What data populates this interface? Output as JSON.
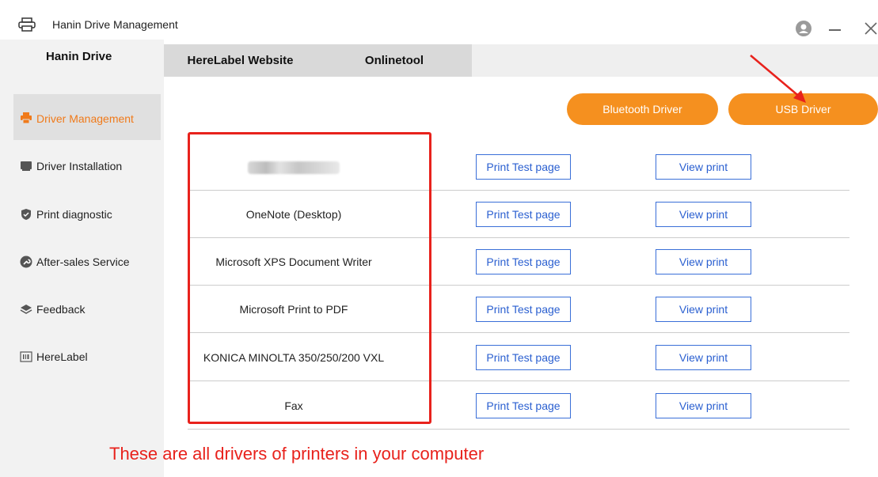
{
  "window": {
    "title": "Hanin Drive Management"
  },
  "tabs": {
    "active": "Hanin Drive",
    "items": [
      "HereLabel Website",
      "Onlinetool"
    ]
  },
  "sidebar": {
    "items": [
      {
        "label": "Driver Management",
        "icon": "printer-icon",
        "active": true
      },
      {
        "label": "Driver Installation",
        "icon": "monitor-icon",
        "active": false
      },
      {
        "label": "Print diagnostic",
        "icon": "shield-icon",
        "active": false
      },
      {
        "label": "After-sales Service",
        "icon": "wrench-icon",
        "active": false
      },
      {
        "label": "Feedback",
        "icon": "layers-icon",
        "active": false
      },
      {
        "label": "HereLabel",
        "icon": "barcode-icon",
        "active": false
      }
    ]
  },
  "actions": {
    "bluetooth": "Bluetooth Driver",
    "usb": "USB Driver"
  },
  "drivers": [
    {
      "name": "",
      "blurred": true,
      "test_label": "Print Test page",
      "view_label": "View print"
    },
    {
      "name": "OneNote (Desktop)",
      "test_label": "Print Test page",
      "view_label": "View print"
    },
    {
      "name": "Microsoft XPS Document Writer",
      "test_label": "Print Test page",
      "view_label": "View print"
    },
    {
      "name": "Microsoft Print to PDF",
      "test_label": "Print Test page",
      "view_label": "View print"
    },
    {
      "name": "KONICA MINOLTA 350/250/200 VXL",
      "test_label": "Print Test page",
      "view_label": "View print"
    },
    {
      "name": "Fax",
      "test_label": "Print Test page",
      "view_label": "View print"
    }
  ],
  "annotation": {
    "caption": "These are all drivers of printers in your computer",
    "color": "#e8221c"
  },
  "colors": {
    "accent": "#f5901f",
    "link": "#2a5fd0"
  }
}
